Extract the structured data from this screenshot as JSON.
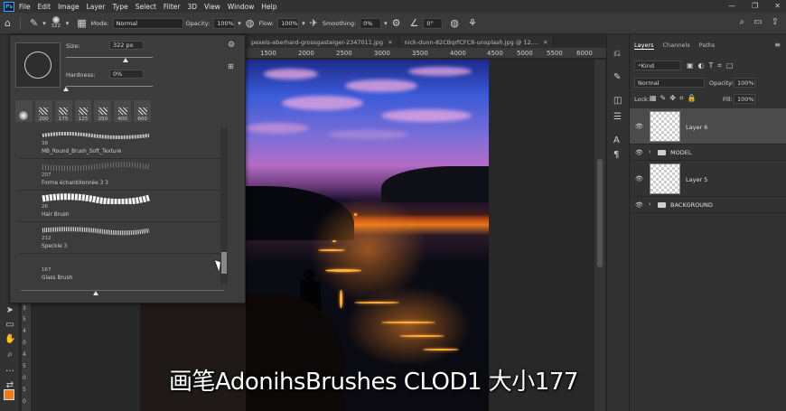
{
  "app": {
    "logo": "Ps"
  },
  "menu": [
    "File",
    "Edit",
    "Image",
    "Layer",
    "Type",
    "Select",
    "Filter",
    "3D",
    "View",
    "Window",
    "Help"
  ],
  "options": {
    "brush_size": "322",
    "mode_label": "Mode:",
    "mode_value": "Normal",
    "opacity_label": "Opacity:",
    "opacity_value": "100%",
    "flow_label": "Flow:",
    "flow_value": "100%",
    "smoothing_label": "Smoothing:",
    "smoothing_value": "0%",
    "angle_value": "0°"
  },
  "tabs": [
    {
      "label": "pexels-eberhard-grossgasteiger-2347011.jpg"
    },
    {
      "label": "nick-dunn-82CBqrfCFC8-unsplash.jpg @ 12,..."
    }
  ],
  "ruler_top": [
    "1500",
    "2000",
    "2500",
    "3000",
    "3500",
    "4000",
    "4500",
    "5000",
    "5500",
    "6000"
  ],
  "ruler_left": [
    "3",
    "5",
    "4",
    "0",
    "4",
    "5",
    "0",
    "5",
    "0"
  ],
  "brush_panel": {
    "size_label": "Size:",
    "size_value": "322 px",
    "hardness_label": "Hardness:",
    "hardness_value": "0%",
    "presets": [
      "200",
      "175",
      "125",
      "250",
      "400",
      "600"
    ],
    "brushes": [
      {
        "size": "38",
        "name": "MB_Round_Brush_Soft_Texture"
      },
      {
        "size": "207",
        "name": "Forme échantillonnée 3 3"
      },
      {
        "size": "26",
        "name": "Hair Brush"
      },
      {
        "size": "212",
        "name": "Speckle 3"
      },
      {
        "size": "167",
        "name": "Glass Brush"
      }
    ]
  },
  "layers_panel": {
    "tabs": [
      "Layers",
      "Channels",
      "Paths"
    ],
    "kind_value": "Kind",
    "blend_value": "Normal",
    "opacity_label": "Opacity:",
    "opacity_value": "100%",
    "lock_label": "Lock:",
    "fill_label": "Fill:",
    "fill_value": "100%",
    "layers": [
      {
        "name": "Layer 6",
        "type": "layer",
        "selected": true
      },
      {
        "name": "MODEL",
        "type": "group"
      },
      {
        "name": "Layer 5",
        "type": "layer"
      },
      {
        "name": "BACKGROUND",
        "type": "group"
      }
    ]
  },
  "subtitle": "画笔AdonihsBrushes CLOD1 大小177",
  "colors": {
    "foreground": "#f07a1c",
    "background": "#111111",
    "accent": "#31a8ff"
  }
}
